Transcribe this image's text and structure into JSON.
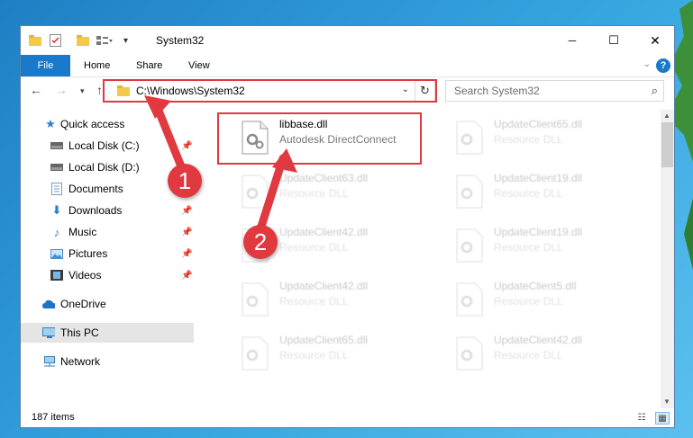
{
  "window": {
    "title": "System32",
    "minimize": "─",
    "maximize": "☐",
    "close": "✕"
  },
  "ribbon": {
    "file": "File",
    "tabs": [
      "Home",
      "Share",
      "View"
    ],
    "help": "?"
  },
  "nav": {
    "address": "C:\\Windows\\System32",
    "search_placeholder": "Search System32"
  },
  "sidebar": {
    "items": [
      {
        "label": "Quick access",
        "icon": "star-icon"
      },
      {
        "label": "Local Disk (C:)",
        "icon": "drive-icon"
      },
      {
        "label": "Local Disk (D:)",
        "icon": "drive-icon"
      },
      {
        "label": "Documents",
        "icon": "documents-icon"
      },
      {
        "label": "Downloads",
        "icon": "downloads-icon"
      },
      {
        "label": "Music",
        "icon": "music-icon"
      },
      {
        "label": "Pictures",
        "icon": "pictures-icon"
      },
      {
        "label": "Videos",
        "icon": "videos-icon"
      },
      {
        "label": "OneDrive",
        "icon": "cloud-icon"
      },
      {
        "label": "This PC",
        "icon": "computer-icon"
      },
      {
        "label": "Network",
        "icon": "network-icon"
      }
    ]
  },
  "files": [
    {
      "name": "libbase.dll",
      "type": "Autodesk DirectConnect"
    },
    {
      "name": "UpdateClient65.dll",
      "type": "Resource DLL"
    },
    {
      "name": "UpdateClient63.dll",
      "type": "Resource DLL"
    },
    {
      "name": "UpdateClient19.dll",
      "type": "Resource DLL"
    },
    {
      "name": "UpdateClient42.dll",
      "type": "Resource DLL"
    },
    {
      "name": "UpdateClient19.dll",
      "type": "Resource DLL"
    },
    {
      "name": "UpdateClient42.dll",
      "type": "Resource DLL"
    },
    {
      "name": "UpdateClient5.dll",
      "type": "Resource DLL"
    },
    {
      "name": "UpdateClient65.dll",
      "type": "Resource DLL"
    },
    {
      "name": "UpdateClient42.dll",
      "type": "Resource DLL"
    }
  ],
  "status": {
    "count": "187 items"
  },
  "markers": {
    "one": "1",
    "two": "2"
  },
  "colors": {
    "accent": "#1979ca",
    "highlight": "#e0393f",
    "selected": "#e5e5e5"
  }
}
